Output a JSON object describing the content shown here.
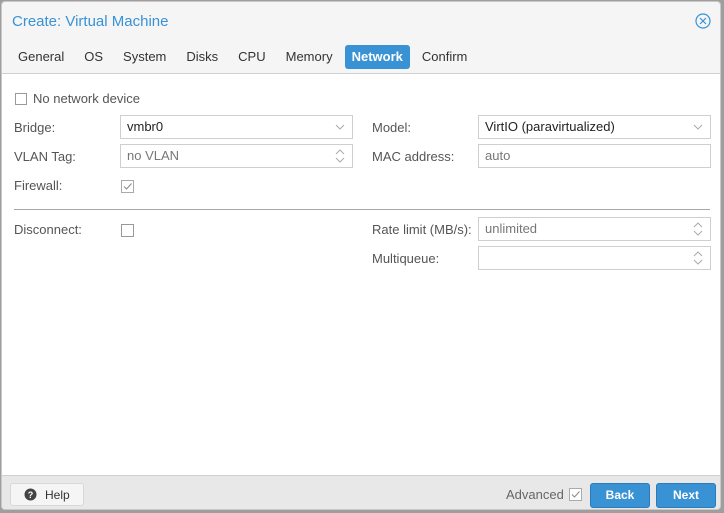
{
  "window": {
    "title": "Create: Virtual Machine"
  },
  "tabs": [
    {
      "label": "General",
      "active": false
    },
    {
      "label": "OS",
      "active": false
    },
    {
      "label": "System",
      "active": false
    },
    {
      "label": "Disks",
      "active": false
    },
    {
      "label": "CPU",
      "active": false
    },
    {
      "label": "Memory",
      "active": false
    },
    {
      "label": "Network",
      "active": true
    },
    {
      "label": "Confirm",
      "active": false
    }
  ],
  "form": {
    "no_network_device": {
      "label": "No network device",
      "checked": false
    },
    "bridge": {
      "label": "Bridge:",
      "value": "vmbr0"
    },
    "vlan_tag": {
      "label": "VLAN Tag:",
      "placeholder": "no VLAN"
    },
    "firewall": {
      "label": "Firewall:",
      "checked": true
    },
    "model": {
      "label": "Model:",
      "value": "VirtIO (paravirtualized)"
    },
    "mac_address": {
      "label": "MAC address:",
      "placeholder": "auto"
    },
    "disconnect": {
      "label": "Disconnect:",
      "checked": false
    },
    "rate_limit": {
      "label": "Rate limit (MB/s):",
      "placeholder": "unlimited"
    },
    "multiqueue": {
      "label": "Multiqueue:",
      "value": ""
    }
  },
  "footer": {
    "help_label": "Help",
    "advanced_label": "Advanced",
    "advanced_checked": true,
    "back_label": "Back",
    "next_label": "Next"
  },
  "colors": {
    "accent": "#3892d4",
    "title": "#3892d4"
  }
}
